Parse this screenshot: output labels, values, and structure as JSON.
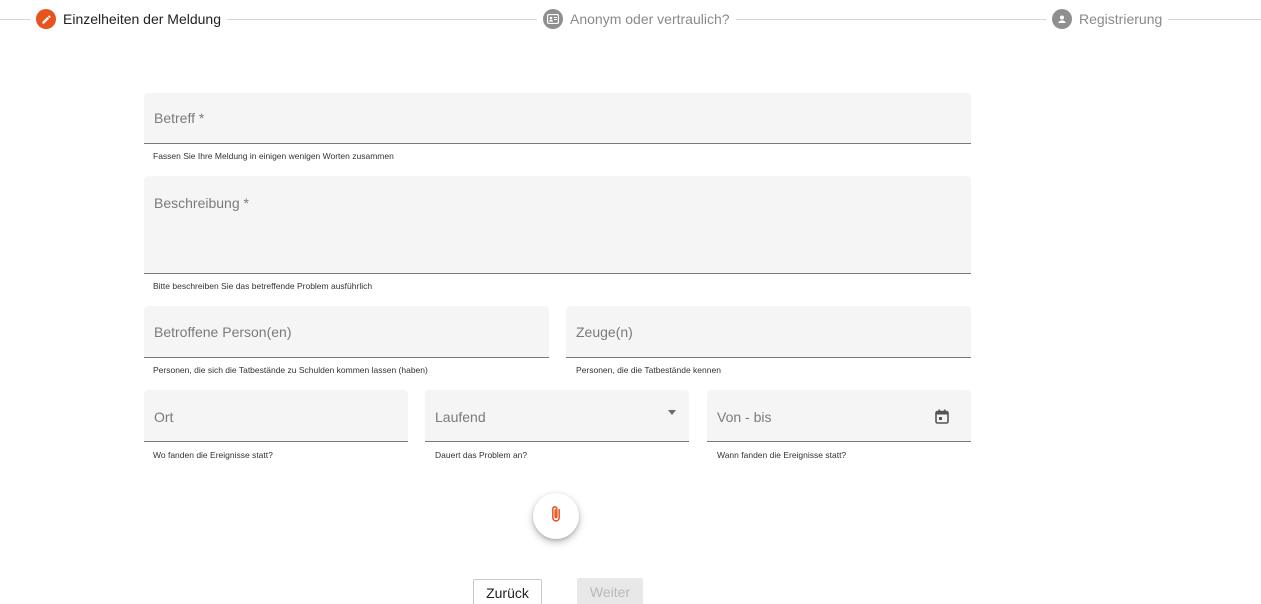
{
  "stepper": {
    "steps": [
      {
        "label": "Einzelheiten der Meldung",
        "icon": "pencil-icon",
        "active": true
      },
      {
        "label": "Anonym oder vertraulich?",
        "icon": "id-card-icon",
        "active": false
      },
      {
        "label": "Registrierung",
        "icon": "user-circle-icon",
        "active": false
      }
    ]
  },
  "form": {
    "betreff": {
      "label": "Betreff *",
      "hint": "Fassen Sie Ihre Meldung in einigen wenigen Worten zusammen"
    },
    "beschreibung": {
      "label": "Beschreibung *",
      "hint": "Bitte beschreiben Sie das betreffende Problem ausführlich"
    },
    "betroffene": {
      "label": "Betroffene Person(en)",
      "hint": "Personen, die sich die Tatbestände zu Schulden kommen lassen (haben)"
    },
    "zeugen": {
      "label": "Zeuge(n)",
      "hint": "Personen, die die Tatbestände kennen"
    },
    "ort": {
      "label": "Ort",
      "hint": "Wo fanden die Ereignisse statt?"
    },
    "laufend": {
      "label": "Laufend",
      "hint": "Dauert das Problem an?"
    },
    "zeitraum": {
      "label": "Von - bis",
      "hint": "Wann fanden die Ereignisse statt?",
      "icon": "calendar-icon"
    }
  },
  "attachment": {
    "icon": "paperclip-icon"
  },
  "buttons": {
    "back": "Zurück",
    "next": "Weiter"
  },
  "colors": {
    "accent": "#e8531e",
    "field_bg": "#f5f5f5",
    "disabled_bg": "#e8e8e8"
  }
}
